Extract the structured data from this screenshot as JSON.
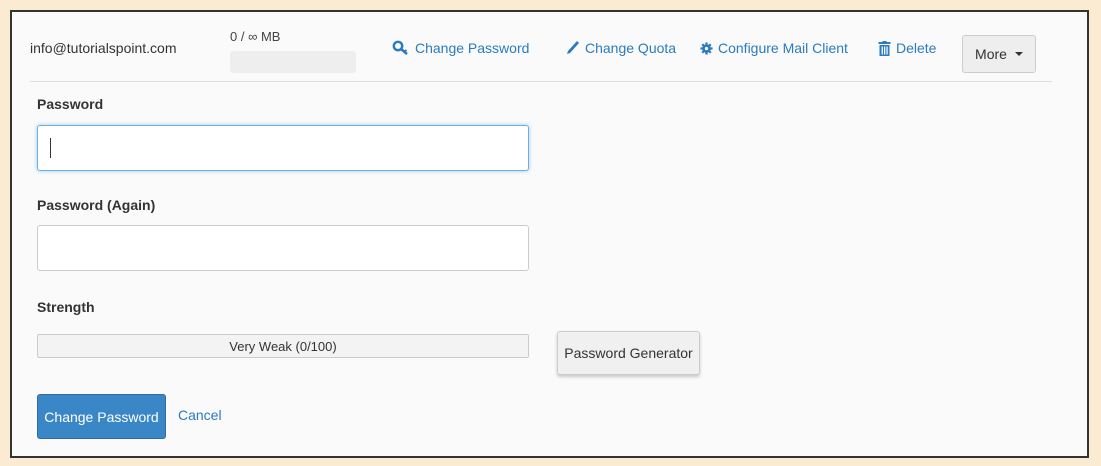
{
  "account": {
    "email": "info@tutorialspoint.com",
    "quota_text": "0 / ∞ MB",
    "quota_used_fraction": 0
  },
  "actions": {
    "change_password": "Change Password",
    "change_quota": "Change Quota",
    "configure_mail_client": "Configure Mail Client",
    "delete": "Delete",
    "more": "More"
  },
  "form": {
    "password_label": "Password",
    "password_value": "",
    "password_again_label": "Password (Again)",
    "password_again_value": "",
    "strength_label": "Strength",
    "strength_text": "Very Weak (0/100)",
    "generator_label": "Password Generator",
    "submit_label": "Change Password",
    "cancel_label": "Cancel"
  },
  "colors": {
    "link": "#2a7bbf",
    "primary": "#3a87c8",
    "background": "#fcebd3"
  }
}
